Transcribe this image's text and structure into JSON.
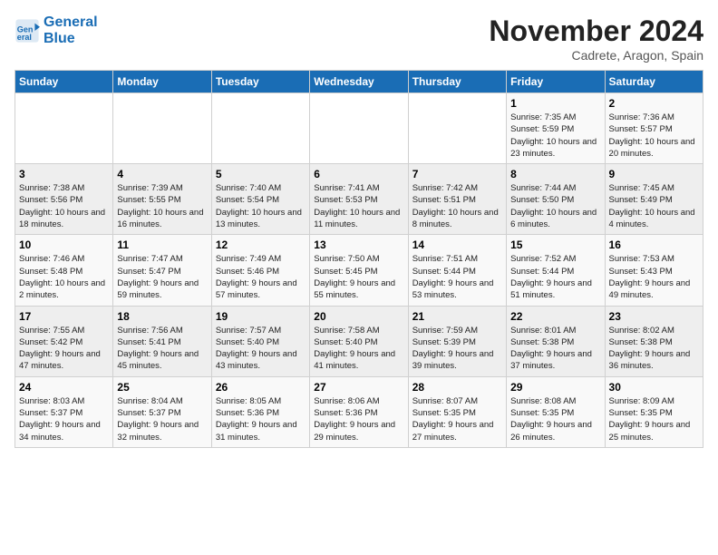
{
  "header": {
    "logo_line1": "General",
    "logo_line2": "Blue",
    "month": "November 2024",
    "location": "Cadrete, Aragon, Spain"
  },
  "weekdays": [
    "Sunday",
    "Monday",
    "Tuesday",
    "Wednesday",
    "Thursday",
    "Friday",
    "Saturday"
  ],
  "weeks": [
    [
      {
        "day": "",
        "info": ""
      },
      {
        "day": "",
        "info": ""
      },
      {
        "day": "",
        "info": ""
      },
      {
        "day": "",
        "info": ""
      },
      {
        "day": "",
        "info": ""
      },
      {
        "day": "1",
        "info": "Sunrise: 7:35 AM\nSunset: 5:59 PM\nDaylight: 10 hours and 23 minutes."
      },
      {
        "day": "2",
        "info": "Sunrise: 7:36 AM\nSunset: 5:57 PM\nDaylight: 10 hours and 20 minutes."
      }
    ],
    [
      {
        "day": "3",
        "info": "Sunrise: 7:38 AM\nSunset: 5:56 PM\nDaylight: 10 hours and 18 minutes."
      },
      {
        "day": "4",
        "info": "Sunrise: 7:39 AM\nSunset: 5:55 PM\nDaylight: 10 hours and 16 minutes."
      },
      {
        "day": "5",
        "info": "Sunrise: 7:40 AM\nSunset: 5:54 PM\nDaylight: 10 hours and 13 minutes."
      },
      {
        "day": "6",
        "info": "Sunrise: 7:41 AM\nSunset: 5:53 PM\nDaylight: 10 hours and 11 minutes."
      },
      {
        "day": "7",
        "info": "Sunrise: 7:42 AM\nSunset: 5:51 PM\nDaylight: 10 hours and 8 minutes."
      },
      {
        "day": "8",
        "info": "Sunrise: 7:44 AM\nSunset: 5:50 PM\nDaylight: 10 hours and 6 minutes."
      },
      {
        "day": "9",
        "info": "Sunrise: 7:45 AM\nSunset: 5:49 PM\nDaylight: 10 hours and 4 minutes."
      }
    ],
    [
      {
        "day": "10",
        "info": "Sunrise: 7:46 AM\nSunset: 5:48 PM\nDaylight: 10 hours and 2 minutes."
      },
      {
        "day": "11",
        "info": "Sunrise: 7:47 AM\nSunset: 5:47 PM\nDaylight: 9 hours and 59 minutes."
      },
      {
        "day": "12",
        "info": "Sunrise: 7:49 AM\nSunset: 5:46 PM\nDaylight: 9 hours and 57 minutes."
      },
      {
        "day": "13",
        "info": "Sunrise: 7:50 AM\nSunset: 5:45 PM\nDaylight: 9 hours and 55 minutes."
      },
      {
        "day": "14",
        "info": "Sunrise: 7:51 AM\nSunset: 5:44 PM\nDaylight: 9 hours and 53 minutes."
      },
      {
        "day": "15",
        "info": "Sunrise: 7:52 AM\nSunset: 5:44 PM\nDaylight: 9 hours and 51 minutes."
      },
      {
        "day": "16",
        "info": "Sunrise: 7:53 AM\nSunset: 5:43 PM\nDaylight: 9 hours and 49 minutes."
      }
    ],
    [
      {
        "day": "17",
        "info": "Sunrise: 7:55 AM\nSunset: 5:42 PM\nDaylight: 9 hours and 47 minutes."
      },
      {
        "day": "18",
        "info": "Sunrise: 7:56 AM\nSunset: 5:41 PM\nDaylight: 9 hours and 45 minutes."
      },
      {
        "day": "19",
        "info": "Sunrise: 7:57 AM\nSunset: 5:40 PM\nDaylight: 9 hours and 43 minutes."
      },
      {
        "day": "20",
        "info": "Sunrise: 7:58 AM\nSunset: 5:40 PM\nDaylight: 9 hours and 41 minutes."
      },
      {
        "day": "21",
        "info": "Sunrise: 7:59 AM\nSunset: 5:39 PM\nDaylight: 9 hours and 39 minutes."
      },
      {
        "day": "22",
        "info": "Sunrise: 8:01 AM\nSunset: 5:38 PM\nDaylight: 9 hours and 37 minutes."
      },
      {
        "day": "23",
        "info": "Sunrise: 8:02 AM\nSunset: 5:38 PM\nDaylight: 9 hours and 36 minutes."
      }
    ],
    [
      {
        "day": "24",
        "info": "Sunrise: 8:03 AM\nSunset: 5:37 PM\nDaylight: 9 hours and 34 minutes."
      },
      {
        "day": "25",
        "info": "Sunrise: 8:04 AM\nSunset: 5:37 PM\nDaylight: 9 hours and 32 minutes."
      },
      {
        "day": "26",
        "info": "Sunrise: 8:05 AM\nSunset: 5:36 PM\nDaylight: 9 hours and 31 minutes."
      },
      {
        "day": "27",
        "info": "Sunrise: 8:06 AM\nSunset: 5:36 PM\nDaylight: 9 hours and 29 minutes."
      },
      {
        "day": "28",
        "info": "Sunrise: 8:07 AM\nSunset: 5:35 PM\nDaylight: 9 hours and 27 minutes."
      },
      {
        "day": "29",
        "info": "Sunrise: 8:08 AM\nSunset: 5:35 PM\nDaylight: 9 hours and 26 minutes."
      },
      {
        "day": "30",
        "info": "Sunrise: 8:09 AM\nSunset: 5:35 PM\nDaylight: 9 hours and 25 minutes."
      }
    ]
  ]
}
